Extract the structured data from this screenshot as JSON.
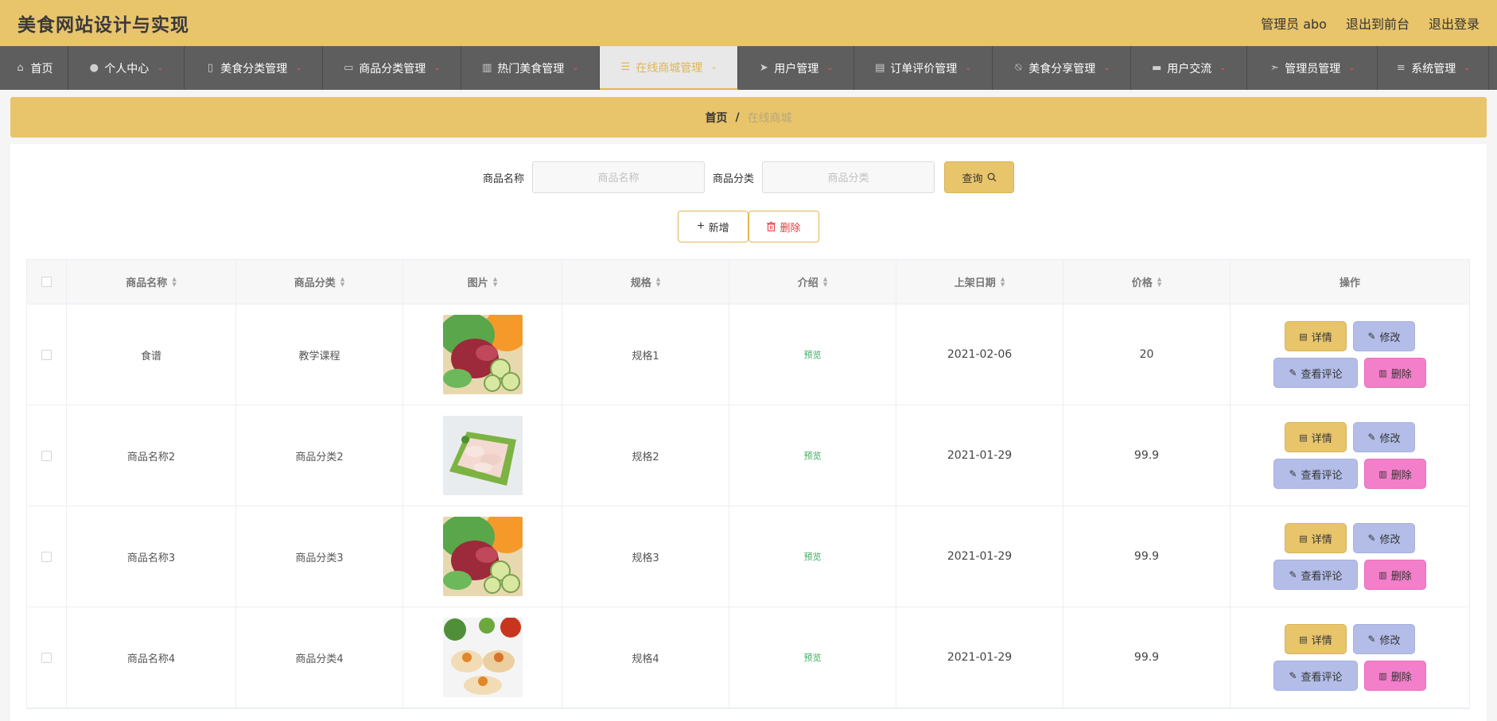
{
  "header": {
    "title": "美食网站设计与实现",
    "user": "管理员 abo",
    "to_front": "退出到前台",
    "logout": "退出登录"
  },
  "nav": [
    {
      "label": "首页",
      "icon": "home-icon",
      "caret": false
    },
    {
      "label": "个人中心",
      "icon": "user-icon",
      "caret": true
    },
    {
      "label": "美食分类管理",
      "icon": "mic-icon",
      "caret": true
    },
    {
      "label": "商品分类管理",
      "icon": "monitor-icon",
      "caret": true
    },
    {
      "label": "热门美食管理",
      "icon": "chart-icon",
      "caret": true
    },
    {
      "label": "在线商城管理",
      "icon": "list-icon",
      "caret": true,
      "active": true
    },
    {
      "label": "用户管理",
      "icon": "send-icon",
      "caret": true
    },
    {
      "label": "订单评价管理",
      "icon": "card-icon",
      "caret": true
    },
    {
      "label": "美食分享管理",
      "icon": "bell-off-icon",
      "caret": true
    },
    {
      "label": "用户交流",
      "icon": "chat-icon",
      "caret": true
    },
    {
      "label": "管理员管理",
      "icon": "location-icon",
      "caret": true
    },
    {
      "label": "系统管理",
      "icon": "settings-icon",
      "caret": true
    }
  ],
  "breadcrumb": {
    "home": "首页",
    "sep": "/",
    "current": "在线商城"
  },
  "search": {
    "name_label": "商品名称",
    "name_placeholder": "商品名称",
    "category_label": "商品分类",
    "category_placeholder": "商品分类",
    "query_label": "查询"
  },
  "actions": {
    "add": "新增",
    "delete": "删除"
  },
  "table": {
    "columns": [
      "商品名称",
      "商品分类",
      "图片",
      "规格",
      "介绍",
      "上架日期",
      "价格",
      "操作"
    ],
    "rows": [
      {
        "name": "食谱",
        "category": "教学课程",
        "image": "salad",
        "spec": "规格1",
        "intro": "预览",
        "date": "2021-02-06",
        "price": "20"
      },
      {
        "name": "商品名称2",
        "category": "商品分类2",
        "image": "platter",
        "spec": "规格2",
        "intro": "预览",
        "date": "2021-01-29",
        "price": "99.9"
      },
      {
        "name": "商品名称3",
        "category": "商品分类3",
        "image": "salad",
        "spec": "规格3",
        "intro": "预览",
        "date": "2021-01-29",
        "price": "99.9"
      },
      {
        "name": "商品名称4",
        "category": "商品分类4",
        "image": "dumplings",
        "spec": "规格4",
        "intro": "预览",
        "date": "2021-01-29",
        "price": "99.9"
      }
    ],
    "ops": {
      "detail": "详情",
      "edit": "修改",
      "comment": "查看评论",
      "delete": "删除"
    }
  }
}
